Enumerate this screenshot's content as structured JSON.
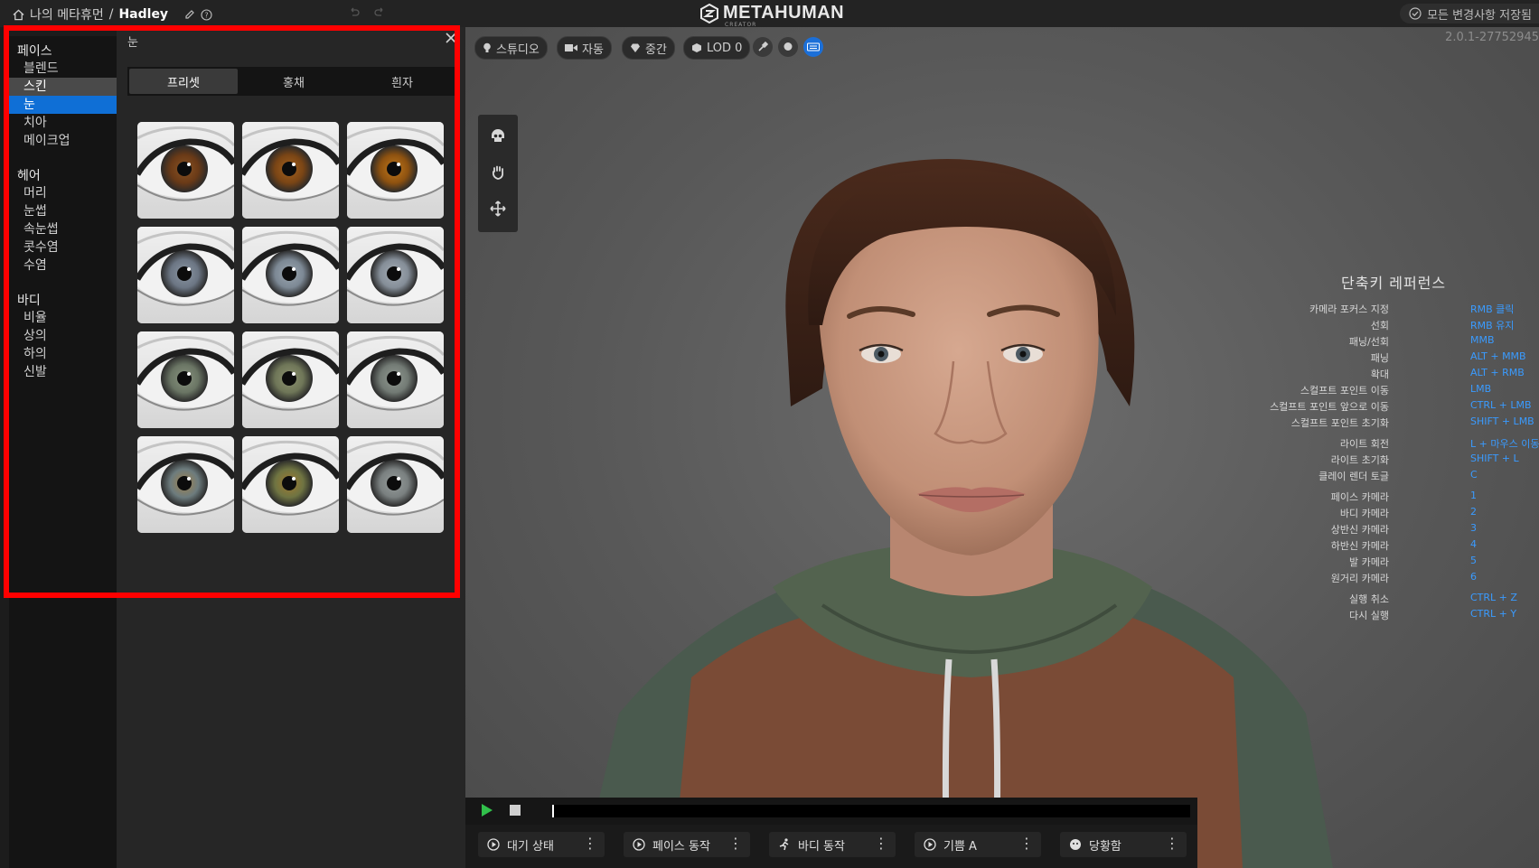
{
  "topbar": {
    "breadcrumb_root": "나의 메타휴먼",
    "separator": "/",
    "character_name": "Hadley",
    "logo": "METAHUMAN",
    "logo_sub": "CREATOR",
    "save_status": "모든 변경사항 저장됨"
  },
  "sidebar": {
    "groups": [
      {
        "label": "페이스",
        "items": [
          "블렌드",
          "스킨",
          "눈",
          "치아",
          "메이크업"
        ]
      },
      {
        "label": "헤어",
        "items": [
          "머리",
          "눈썹",
          "속눈썹",
          "콧수염",
          "수염"
        ]
      },
      {
        "label": "바디",
        "items": [
          "비율",
          "상의",
          "하의",
          "신발"
        ]
      }
    ],
    "hovered": "스킨",
    "selected": "눈"
  },
  "panel": {
    "title": "눈",
    "tabs": [
      "프리셋",
      "홍채",
      "흰자"
    ],
    "active_tab": "프리셋",
    "presets": [
      {
        "iris": "#6a3a17",
        "inner": "#8a5424"
      },
      {
        "iris": "#7a4515",
        "inner": "#a4621f"
      },
      {
        "iris": "#8e5210",
        "inner": "#c0781c"
      },
      {
        "iris": "#6c7684",
        "inner": "#8c97a4"
      },
      {
        "iris": "#7c8894",
        "inner": "#9ca7b1"
      },
      {
        "iris": "#858e98",
        "inner": "#a5adb5"
      },
      {
        "iris": "#6a7564",
        "inner": "#8a9480"
      },
      {
        "iris": "#6f7658",
        "inner": "#8d9270"
      },
      {
        "iris": "#727a74",
        "inner": "#929a92"
      },
      {
        "iris": "#6d7c7e",
        "inner": "#a0824e"
      },
      {
        "iris": "#6f7442",
        "inner": "#a07a30"
      },
      {
        "iris": "#7a8080",
        "inner": "#979d9c"
      }
    ]
  },
  "viewport": {
    "toolbar": {
      "lighting": "스튜디오",
      "camera": "자동",
      "quality": "중간",
      "lod": "LOD 0"
    },
    "version": "2.0.1-27752945",
    "shortcuts_title": "단축키 레퍼런스",
    "shortcuts": [
      {
        "action": "카메라 포커스 지정",
        "key": "RMB 클릭"
      },
      {
        "action": "선회",
        "key": "RMB 유지"
      },
      {
        "action": "패닝/선회",
        "key": "MMB"
      },
      {
        "action": "패닝",
        "key": "ALT + MMB"
      },
      {
        "action": "확대",
        "key": "ALT + RMB"
      },
      {
        "action": "스컬프트 포인트 이동",
        "key": "LMB"
      },
      {
        "action": "스컬프트 포인트 앞으로 이동",
        "key": "CTRL + LMB"
      },
      {
        "action": "스컬프트 포인트 초기화",
        "key": "SHIFT + LMB"
      },
      {
        "action": "라이트 회전",
        "key": "L + 마우스 이동"
      },
      {
        "action": "라이트 초기화",
        "key": "SHIFT + L"
      },
      {
        "action": "클레이 렌더 토글",
        "key": "C"
      },
      {
        "action": "페이스 카메라",
        "key": "1"
      },
      {
        "action": "바디 카메라",
        "key": "2"
      },
      {
        "action": "상반신 카메라",
        "key": "3"
      },
      {
        "action": "하반신 카메라",
        "key": "4"
      },
      {
        "action": "발 카메라",
        "key": "5"
      },
      {
        "action": "원거리 카메라",
        "key": "6"
      },
      {
        "action": "실행 취소",
        "key": "CTRL + Z"
      },
      {
        "action": "다시 실행",
        "key": "CTRL + Y"
      }
    ]
  },
  "poses": [
    "대기 상태",
    "페이스 동작",
    "바디 동작",
    "기쁨 A",
    "당황함"
  ],
  "colors": {
    "accent": "#0f6fd6",
    "highlight_box": "#ff0000",
    "shortcut_key": "#3a9bff",
    "play": "#31c04b"
  }
}
